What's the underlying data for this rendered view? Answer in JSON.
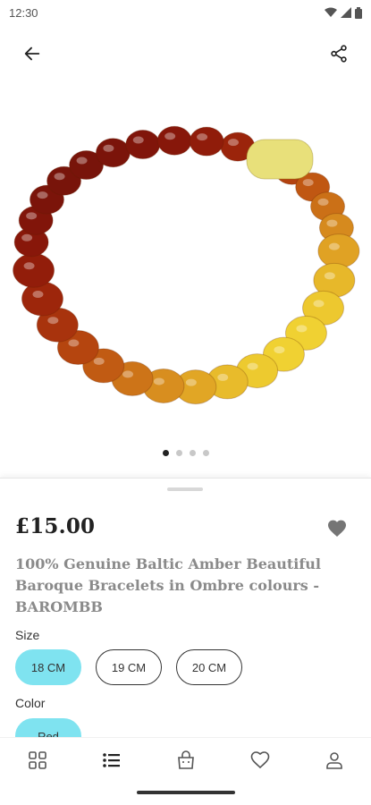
{
  "status_bar": {
    "time": "12:30"
  },
  "icons": {
    "back": "arrow-left-icon",
    "share": "share-icon",
    "favorite": "heart-icon",
    "nav": [
      "categories-icon",
      "list-icon",
      "bag-icon",
      "heart-icon",
      "profile-icon"
    ]
  },
  "carousel": {
    "total": 4,
    "active": 1
  },
  "product": {
    "price": "£15.00",
    "title": "100% Genuine Baltic Amber Beautiful Baroque Bracelets in Ombre colours - BAROMBB"
  },
  "size": {
    "label": "Size",
    "options": [
      "18 CM",
      "19 CM",
      "20 CM"
    ],
    "selected": "18 CM"
  },
  "color": {
    "label": "Color",
    "options": [
      "Red"
    ],
    "selected": "Red"
  },
  "colors": {
    "accent": "#7fe3f0",
    "title_text": "#8a8a8a",
    "price_text": "#222222"
  }
}
